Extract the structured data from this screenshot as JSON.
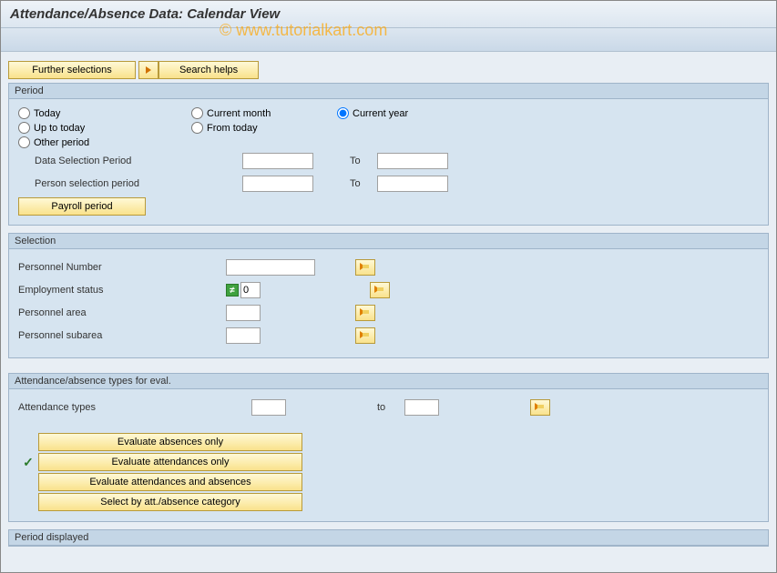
{
  "title": "Attendance/Absence Data: Calendar View",
  "watermark": "© www.tutorialkart.com",
  "toolbar": {
    "further_selections": "Further selections",
    "search_helps": "Search helps"
  },
  "period": {
    "group_title": "Period",
    "radios": {
      "today": "Today",
      "current_month": "Current month",
      "current_year": "Current year",
      "up_to_today": "Up to today",
      "from_today": "From today",
      "other_period": "Other period"
    },
    "data_sel_label": "Data Selection Period",
    "person_sel_label": "Person selection period",
    "to_label": "To",
    "data_sel_from": "",
    "data_sel_to": "",
    "person_sel_from": "",
    "person_sel_to": "",
    "payroll_period": "Payroll period"
  },
  "selection": {
    "group_title": "Selection",
    "personnel_number_label": "Personnel Number",
    "personnel_number": "",
    "employment_status_label": "Employment status",
    "employment_status": "0",
    "personnel_area_label": "Personnel area",
    "personnel_area": "",
    "personnel_subarea_label": "Personnel subarea",
    "personnel_subarea": ""
  },
  "eval": {
    "group_title": "Attendance/absence types for eval.",
    "attendance_types_label": "Attendance types",
    "attendance_types_from": "",
    "to_label": "to",
    "attendance_types_to": "",
    "btn_absences_only": "Evaluate absences only",
    "btn_attendances_only": "Evaluate attendances only",
    "btn_both": "Evaluate attendances and absences",
    "btn_category": "Select by att./absence category"
  },
  "period_displayed": {
    "group_title": "Period displayed"
  },
  "status_icon_text": "≠"
}
